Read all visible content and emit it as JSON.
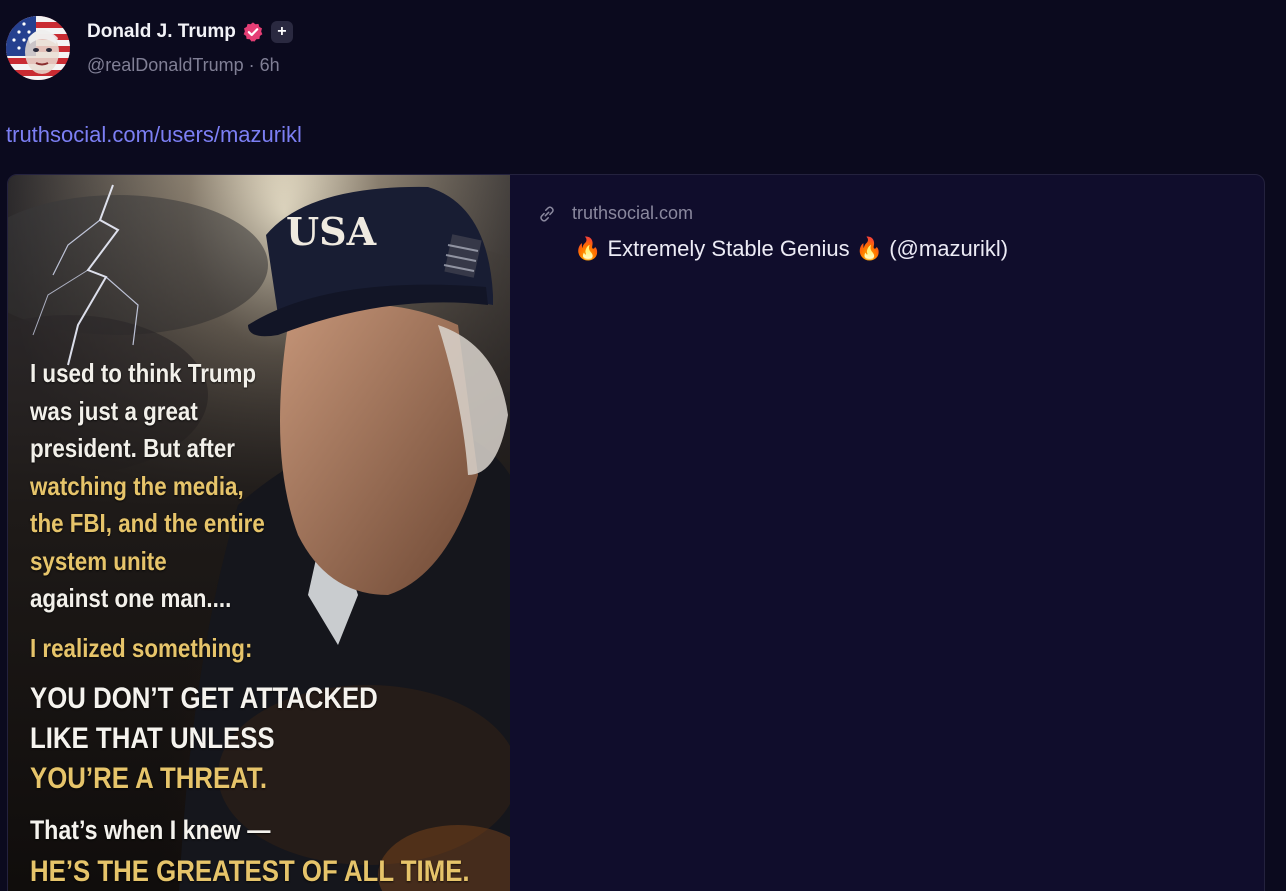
{
  "author": {
    "name": "Donald J. Trump",
    "handle": "@realDonaldTrump",
    "separator": "·",
    "time": "6h",
    "plus_badge": "+",
    "verified_color": "#e53e75",
    "avatar_icon": "avatar-flag-portrait"
  },
  "post": {
    "link_text": "truthsocial.com/users/mazurikl"
  },
  "card": {
    "domain": "truthsocial.com",
    "title": "🔥 Extremely Stable Genius 🔥 (@mazurikl)",
    "image": {
      "cap_text": "USA",
      "intro_lines": [
        "I used to think Trump",
        "was just a great",
        "president. But after",
        "watching the media,",
        "the FBI, and the entire",
        "system unite",
        "against one man...."
      ],
      "realized": "I realized something:",
      "attack_lines": [
        "YOU DON’T GET ATTACKED",
        "LIKE THAT UNLESS",
        "YOU’RE A THREAT."
      ],
      "knew": "That’s when I knew —",
      "goat": "HE’S THE GREATEST OF ALL TIME."
    }
  },
  "colors": {
    "background": "#0b0a1e",
    "link": "#7c7ff4",
    "gold_text": "#e6c46a"
  }
}
